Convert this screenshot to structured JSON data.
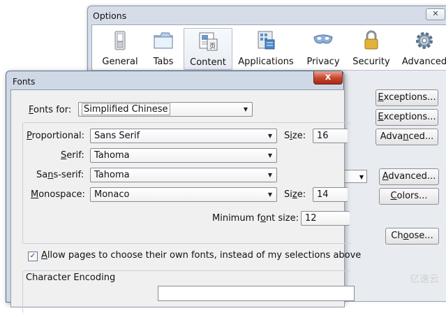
{
  "options_window": {
    "title": "Options",
    "close_glyph": "✕",
    "panes": [
      {
        "label": "General",
        "icon": "general-switch-icon"
      },
      {
        "label": "Tabs",
        "icon": "tabs-icon"
      },
      {
        "label": "Content",
        "icon": "content-page-icon",
        "selected": true
      },
      {
        "label": "Applications",
        "icon": "applications-icon"
      },
      {
        "label": "Privacy",
        "icon": "privacy-mask-icon"
      },
      {
        "label": "Security",
        "icon": "security-lock-icon"
      },
      {
        "label": "Advanced",
        "icon": "advanced-gear-icon"
      }
    ],
    "buttons": {
      "exceptions1": {
        "pre": "",
        "u": "E",
        "post": "xceptions..."
      },
      "exceptions2": {
        "pre": "",
        "u": "E",
        "post": "xceptions..."
      },
      "advanced1": {
        "pre": "Adva",
        "u": "n",
        "post": "ced..."
      },
      "advanced2": {
        "pre": "",
        "u": "A",
        "post": "dvanced..."
      },
      "colors": {
        "pre": "",
        "u": "C",
        "post": "olors..."
      },
      "choose": {
        "pre": "Ch",
        "u": "o",
        "post": "ose..."
      }
    }
  },
  "fonts_dialog": {
    "title": "Fonts",
    "close_glyph": "x",
    "fonts_for": {
      "label_u": "F",
      "label_rest": "onts for:",
      "value": "Simplified Chinese"
    },
    "proportional": {
      "label_u": "P",
      "label_rest": "roportional:",
      "value": "Sans Serif"
    },
    "serif": {
      "label_u": "S",
      "label_rest": "erif:",
      "value": "Tahoma"
    },
    "sans_serif": {
      "label_pre": "Sa",
      "label_u": "n",
      "label_rest": "s-serif:",
      "value": "Tahoma"
    },
    "monospace": {
      "label_u": "M",
      "label_rest": "onospace:",
      "value": "Monaco"
    },
    "size_prop": {
      "label_pre": "S",
      "label_u": "i",
      "label_rest": "ze:",
      "value": "16"
    },
    "size_mono": {
      "label_pre": "Si",
      "label_u": "z",
      "label_rest": "e:",
      "value": "14"
    },
    "min_size": {
      "label_pre": "Minimum f",
      "label_u": "o",
      "label_rest": "nt size:",
      "value": "12"
    },
    "allow_pages": {
      "checked": true,
      "glyph": "✓",
      "label_u": "A",
      "label_rest": "llow pages to choose their own fonts, instead of my selections above"
    },
    "char_encoding_heading": "Character Encoding"
  },
  "watermark": "亿速云"
}
